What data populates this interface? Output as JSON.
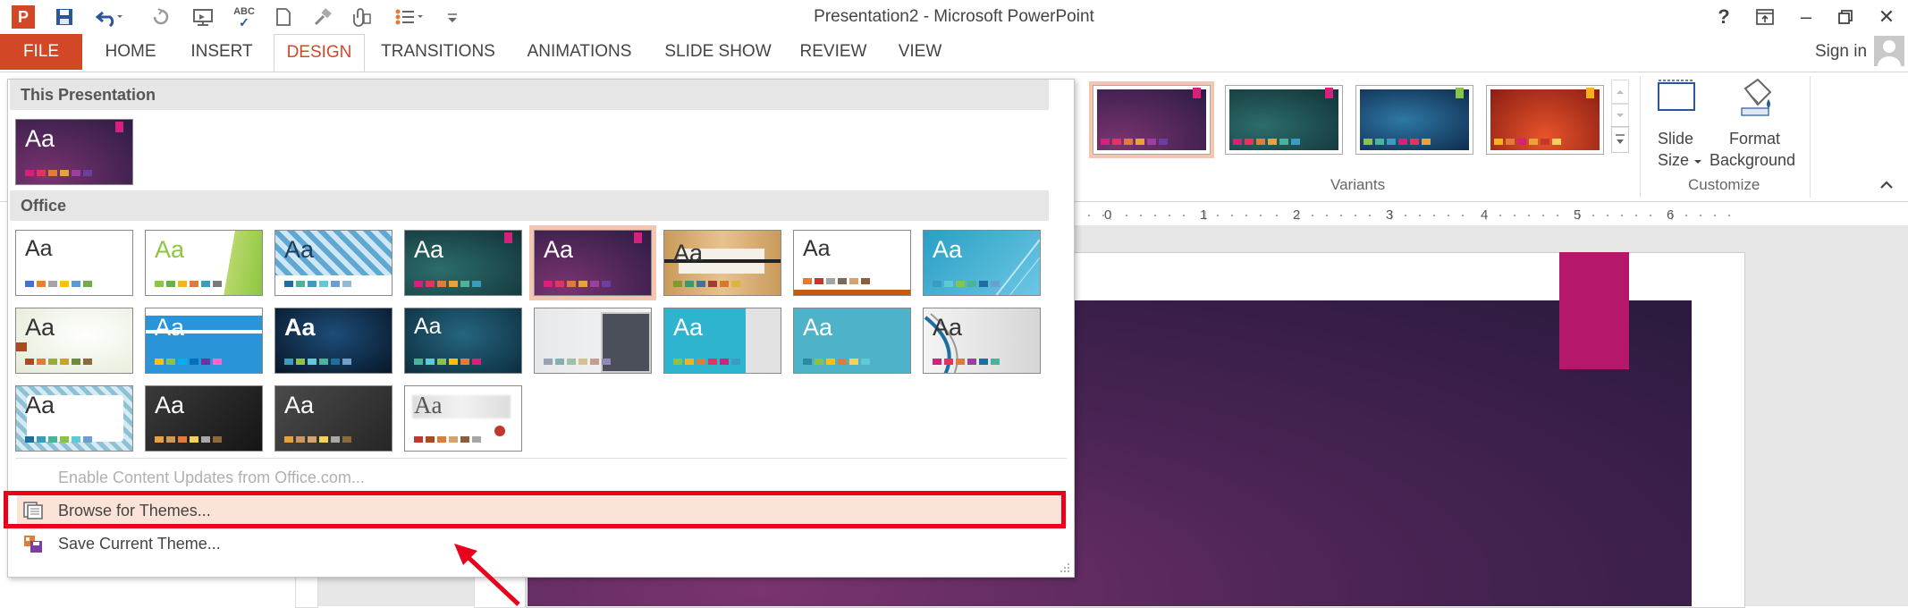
{
  "window": {
    "title": "Presentation2 - Microsoft PowerPoint",
    "help": "?",
    "restore_ribbon": "⧉",
    "minimize": "–",
    "maximize": "🗗",
    "close": "✕"
  },
  "qat": {
    "app_icon": "P",
    "save_icon": "save-icon",
    "undo_icon": "undo-icon",
    "redo_icon": "redo-icon",
    "spelling_label": "ABC"
  },
  "tabs": [
    {
      "label": "FILE"
    },
    {
      "label": "HOME"
    },
    {
      "label": "INSERT"
    },
    {
      "label": "DESIGN"
    },
    {
      "label": "TRANSITIONS"
    },
    {
      "label": "ANIMATIONS"
    },
    {
      "label": "SLIDE SHOW"
    },
    {
      "label": "REVIEW"
    },
    {
      "label": "VIEW"
    }
  ],
  "sign_in": "Sign in",
  "ribbon": {
    "variants_label": "Variants",
    "customize_label": "Customize",
    "slide_size_line1": "Slide",
    "slide_size_line2": "Size",
    "format_bg_line1": "Format",
    "format_bg_line2": "Background"
  },
  "ruler": {
    "ticks": [
      "0",
      "1",
      "2",
      "3",
      "4",
      "5",
      "6"
    ]
  },
  "dropdown": {
    "section_this": "This Presentation",
    "section_office": "Office",
    "theme_text": "Aa",
    "enable_updates": "Enable Content Updates from Office.com...",
    "browse": "Browse for Themes...",
    "save_theme": "Save Current Theme..."
  },
  "colors": {
    "accent": "#d24726",
    "highlight_border": "#e8001c",
    "browse_hover": "#fbe3d8",
    "theme_tag": "#b5176a"
  }
}
